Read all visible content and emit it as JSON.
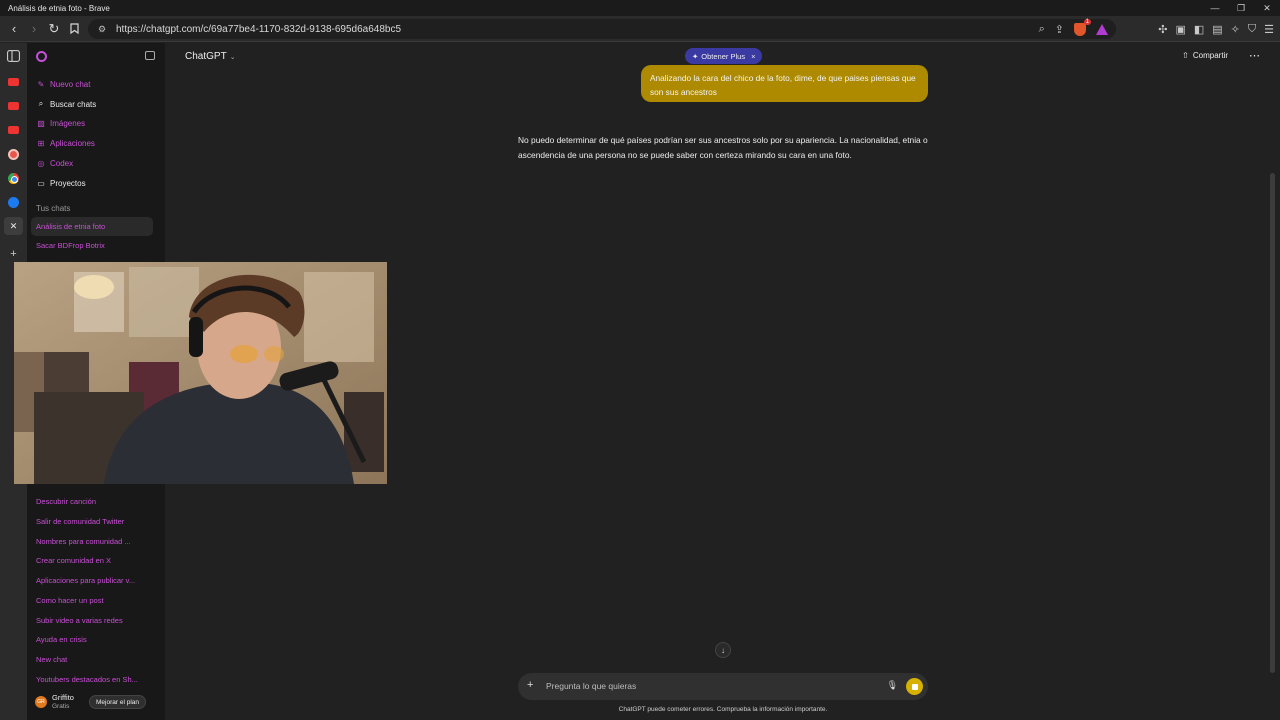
{
  "window": {
    "title": "Análisis de etnia foto - Brave",
    "controls": [
      "—",
      "❐",
      "✕"
    ]
  },
  "browser": {
    "url": "https://chatgpt.com/c/69a77be4-1170-832d-9138-695d6a648bc5",
    "shield_badge": "1"
  },
  "sidebar": {
    "nav": [
      {
        "label": "Nuevo chat",
        "icon": "new-chat-icon"
      },
      {
        "label": "Buscar chats",
        "icon": "search-icon"
      },
      {
        "label": "Imágenes",
        "icon": "image-icon"
      },
      {
        "label": "Aplicaciones",
        "icon": "apps-icon"
      },
      {
        "label": "Codex",
        "icon": "codex-icon"
      },
      {
        "label": "Proyectos",
        "icon": "folder-icon"
      }
    ],
    "section_title": "Tus chats",
    "chats_top": [
      "Análisis de etnia foto",
      "Sacar BDFrop Botrix"
    ],
    "chats_bottom": [
      "Descubrir canción",
      "Salir de comunidad Twitter",
      "Nombres para comunidad ...",
      "Crear comunidad en X",
      "Aplicaciones para publicar v...",
      "Como hacer un post",
      "Subir video a varias redes",
      "Ayuda en crisis",
      "New chat",
      "Youtubers destacados en Sh..."
    ],
    "user": {
      "initials": "GR",
      "name": "Griffito",
      "plan": "Gratis",
      "upgrade_label": "Mejorar el plan"
    }
  },
  "header": {
    "model": "ChatGPT",
    "plus_pill": "Obtener Plus",
    "share_label": "Compartir"
  },
  "conversation": {
    "user_message": "Analizando la cara del chico de la foto, dime, de que paises piensas que son sus ancestros",
    "assistant_message": "No puedo determinar de qué países podrían ser sus ancestros solo por su apariencia. La nacionalidad, etnia o ascendencia de una persona no se puede saber con certeza mirando su cara en una foto."
  },
  "composer": {
    "placeholder": "Pregunta lo que quieras"
  },
  "disclaimer": "ChatGPT puede cometer errores. Comprueba la información importante.",
  "colors": {
    "accent_pink": "#c94fd6",
    "user_bubble": "#ad8a00",
    "plus_pill": "#3b3aa3",
    "stop_button": "#d6b100"
  }
}
